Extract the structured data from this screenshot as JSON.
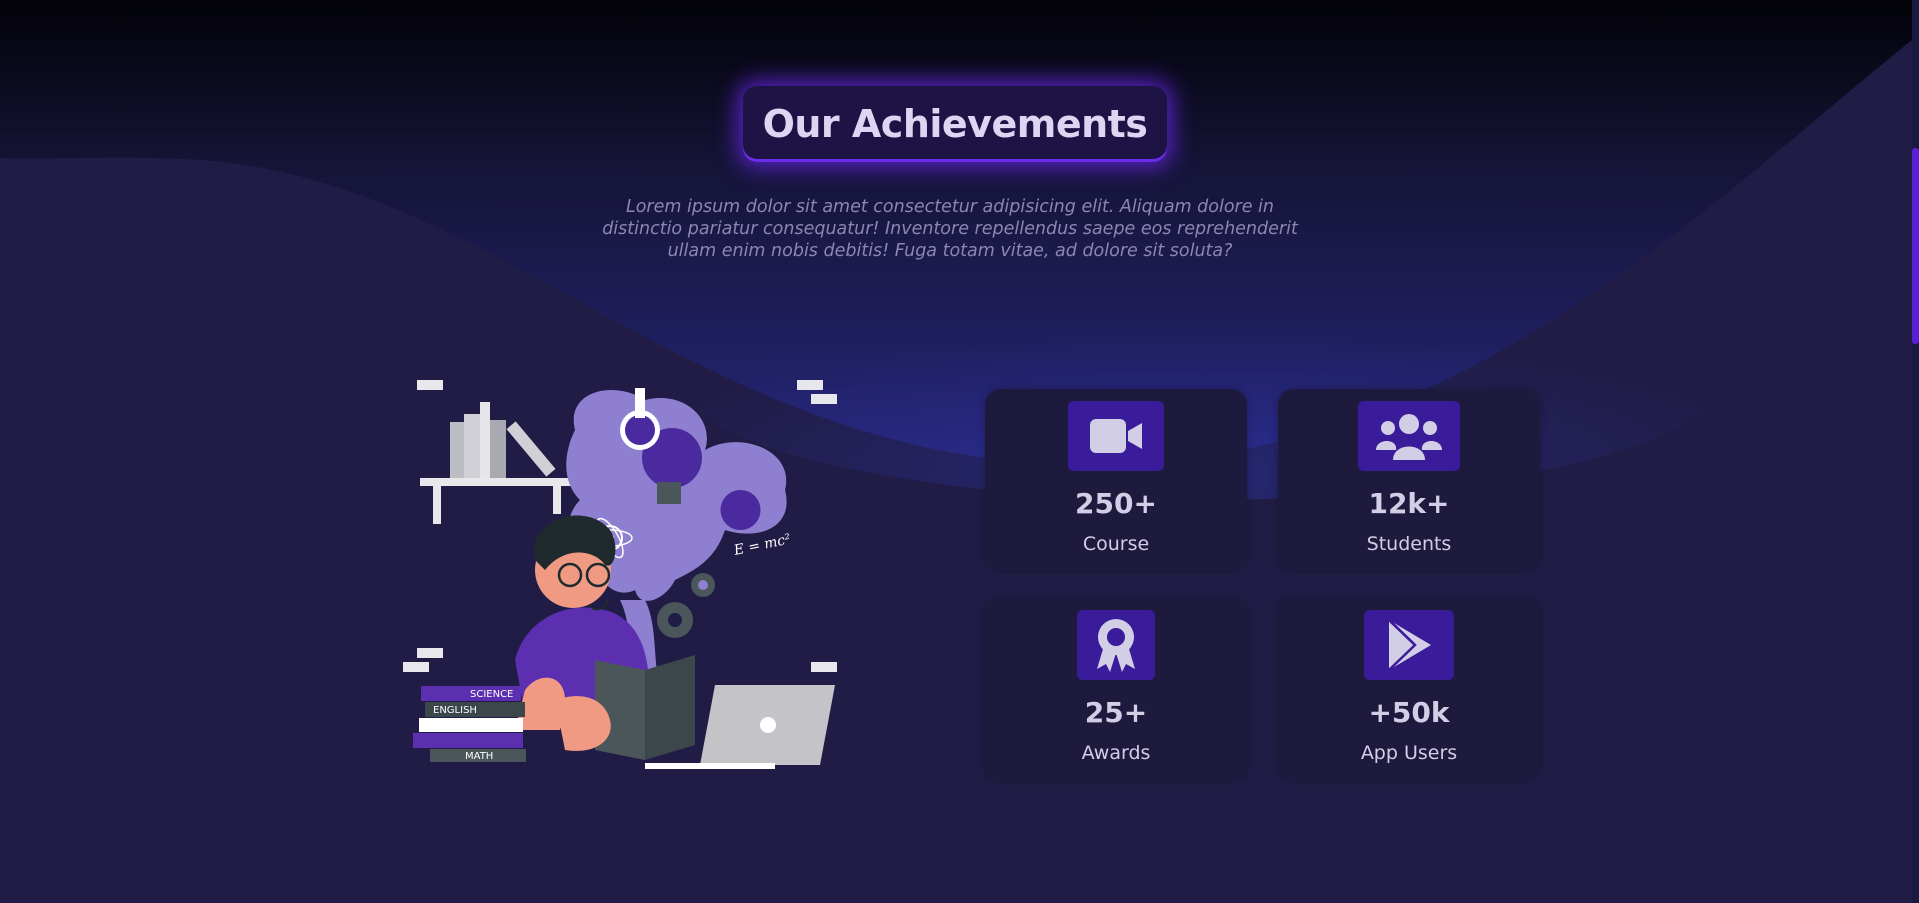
{
  "section": {
    "title": "Our Achievements",
    "description": "Lorem ipsum dolor sit amet consectetur adipisicing elit. Aliquam dolore in distinctio pariatur consequatur! Inventore repellendus saepe eos reprehenderit ullam enim nobis debitis! Fuga totam vitae, ad dolore sit soluta?"
  },
  "illustration": {
    "books": [
      "SCIENCE",
      "ENGLISH",
      "MATH"
    ],
    "formula": "E = mc²"
  },
  "stats": [
    {
      "value": "250+",
      "label": "Course",
      "icon": "video-camera-icon"
    },
    {
      "value": "12k+",
      "label": "Students",
      "icon": "users-group-icon"
    },
    {
      "value": "25+",
      "label": "Awards",
      "icon": "award-ribbon-icon"
    },
    {
      "value": "+50k",
      "label": "App Users",
      "icon": "google-play-icon"
    }
  ],
  "colors": {
    "background": "#201c45",
    "accent": "#6a2ee8",
    "icon_bg": "#3a1b9a",
    "card_bg": "#1d1a3e",
    "text": "#d2cee6"
  }
}
